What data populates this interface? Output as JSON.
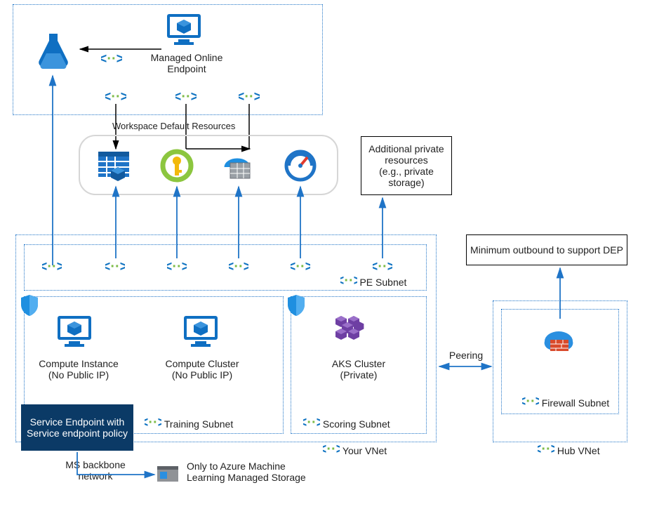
{
  "topBox": {
    "managedEndpoint": "Managed Online Endpoint"
  },
  "workspaceResourcesLabel": "Workspace Default Resources",
  "additionalResources": "Additional private resources\n(e.g., private storage)",
  "vnet": {
    "peSubnet": "PE Subnet",
    "trainingSubnet": "Training Subnet",
    "scoringSubnet": "Scoring Subnet",
    "yourVnet": "Your VNet",
    "computeInstance": "Compute Instance\n(No Public IP)",
    "computeCluster": "Compute Cluster\n(No Public IP)",
    "aksCluster": "AKS Cluster\n(Private)"
  },
  "serviceEndpoint": "Service Endpoint with  Service endpoint policy",
  "msBackbone": "MS backbone network",
  "managedStorage": "Only to Azure Machine Learning Managed Storage",
  "peering": "Peering",
  "hubVnet": "Hub VNet",
  "firewallSubnet": "Firewall Subnet",
  "minOutbound": "Minimum outbound to support DEP",
  "icons": {
    "ml_workspace": "azure-ml-workspace-icon",
    "monitor_box": "managed-endpoint-icon",
    "storage": "storage-icon",
    "keyvault": "key-vault-icon",
    "container_registry": "container-registry-icon",
    "app_insights": "app-insights-icon",
    "shield": "shield-icon",
    "cluster": "aks-cluster-icon",
    "firewall": "firewall-icon",
    "storage_small": "storage-small-icon",
    "pe": "private-endpoint-icon"
  }
}
